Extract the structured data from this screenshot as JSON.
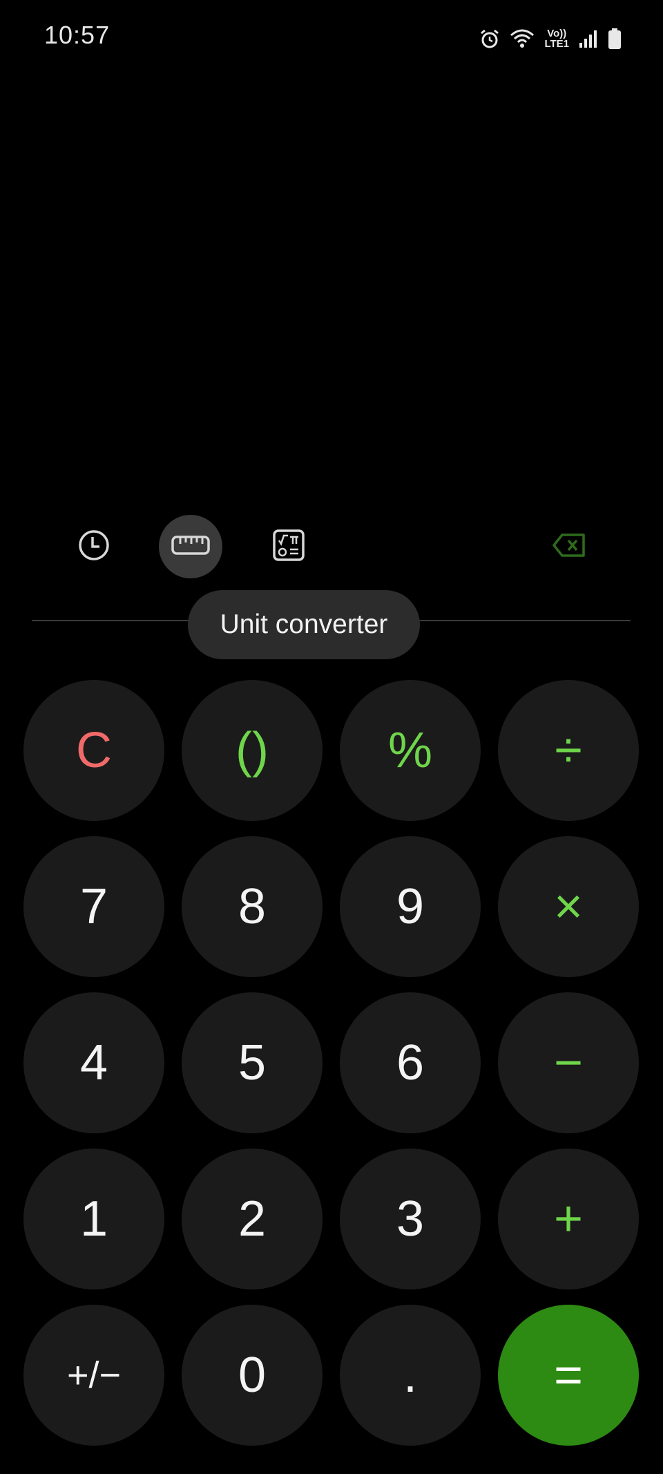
{
  "status_bar": {
    "time": "10:57",
    "volte_top": "Vo))",
    "volte_bottom": "LTE1",
    "icons": [
      "alarm-icon",
      "wifi-icon",
      "volte-icon",
      "signal-icon",
      "battery-icon"
    ]
  },
  "toolbar": {
    "history_icon": "clock-icon",
    "unit_converter_icon": "ruler-icon",
    "scientific_icon": "scientific-icon",
    "backspace_icon": "backspace-icon",
    "tooltip": "Unit converter"
  },
  "keypad": {
    "rows": [
      [
        "C",
        "()",
        "%",
        "÷"
      ],
      [
        "7",
        "8",
        "9",
        "×"
      ],
      [
        "4",
        "5",
        "6",
        "−"
      ],
      [
        "1",
        "2",
        "3",
        "+"
      ],
      [
        "+/−",
        "0",
        ".",
        "="
      ]
    ]
  },
  "colors": {
    "background": "#000000",
    "key": "#1b1b1b",
    "clear": "#f06a6a",
    "operator": "#6fd54a",
    "equals": "#2d8a12"
  }
}
